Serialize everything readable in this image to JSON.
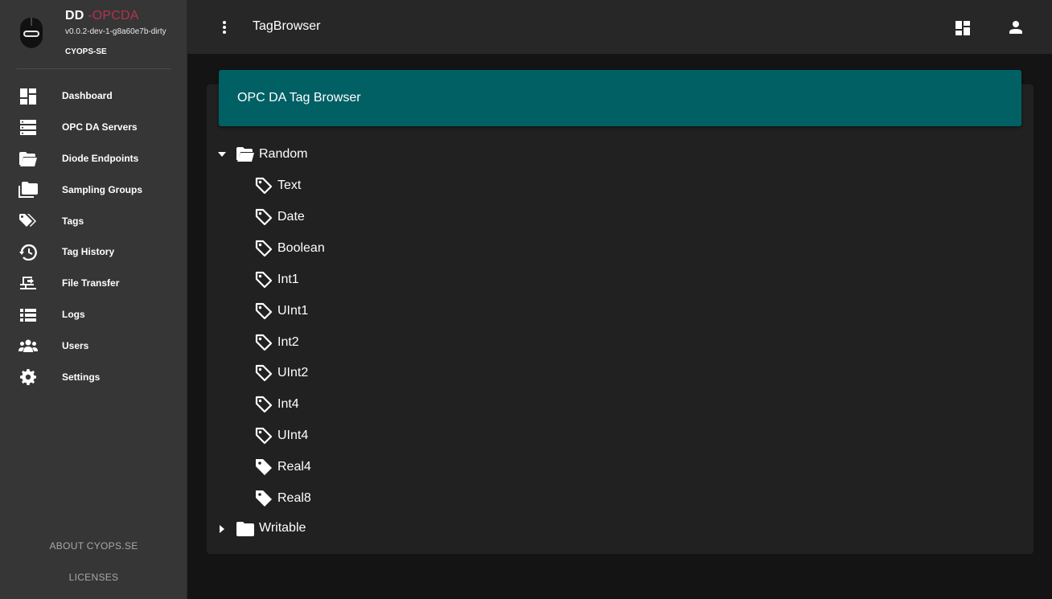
{
  "brand": {
    "title_main": "DD",
    "title_accent": " -OPCDA",
    "version": "v0.0.2-dev-1-g8a60e7b-dirty",
    "org": "CYOPS-SE"
  },
  "nav": {
    "items": [
      {
        "label": "Dashboard",
        "icon": "dashboard-icon"
      },
      {
        "label": "OPC DA Servers",
        "icon": "server-icon"
      },
      {
        "label": "Diode Endpoints",
        "icon": "folder-open-icon"
      },
      {
        "label": "Sampling Groups",
        "icon": "folders-icon"
      },
      {
        "label": "Tags",
        "icon": "tags-icon"
      },
      {
        "label": "Tag History",
        "icon": "history-icon"
      },
      {
        "label": "File Transfer",
        "icon": "file-transfer-icon"
      },
      {
        "label": "Logs",
        "icon": "list-icon"
      },
      {
        "label": "Users",
        "icon": "users-icon"
      },
      {
        "label": "Settings",
        "icon": "gear-icon"
      }
    ],
    "footer": {
      "about": "ABOUT CYOPS.SE",
      "licenses": "LICENSES"
    }
  },
  "topbar": {
    "title": "TagBrowser"
  },
  "card": {
    "title": "OPC DA Tag Browser"
  },
  "tree": {
    "folders": [
      {
        "label": "Random",
        "expanded": true,
        "children": [
          {
            "label": "Text",
            "icon": "tag-outline-icon"
          },
          {
            "label": "Date",
            "icon": "tag-outline-icon"
          },
          {
            "label": "Boolean",
            "icon": "tag-outline-icon"
          },
          {
            "label": "Int1",
            "icon": "tag-outline-icon"
          },
          {
            "label": "UInt1",
            "icon": "tag-outline-icon"
          },
          {
            "label": "Int2",
            "icon": "tag-outline-icon"
          },
          {
            "label": "UInt2",
            "icon": "tag-outline-icon"
          },
          {
            "label": "Int4",
            "icon": "tag-outline-icon"
          },
          {
            "label": "UInt4",
            "icon": "tag-outline-icon"
          },
          {
            "label": "Real4",
            "icon": "tag-filled-icon"
          },
          {
            "label": "Real8",
            "icon": "tag-filled-icon"
          }
        ]
      },
      {
        "label": "Writable",
        "expanded": false,
        "children": []
      }
    ]
  },
  "colors": {
    "sidebar_bg": "#363636",
    "topbar_bg": "#272727",
    "page_bg": "#141414",
    "card_bg": "#212121",
    "header_bg": "#006064",
    "accent": "#b5334e"
  }
}
